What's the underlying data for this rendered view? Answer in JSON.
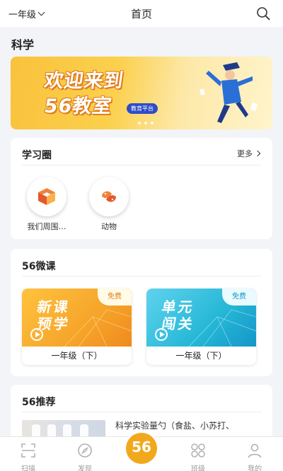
{
  "header": {
    "grade": "一年级",
    "title": "首页"
  },
  "subject": "科学",
  "banner": {
    "line1": "欢迎来到",
    "line2": "56教室",
    "tag": "教育平台"
  },
  "study_circle": {
    "title": "学习圈",
    "more": "更多",
    "items": [
      {
        "label": "我们周围…",
        "icon": "cube-icon"
      },
      {
        "label": "动物",
        "icon": "fish-icon"
      }
    ]
  },
  "micro_lessons": {
    "title": "56微课",
    "items": [
      {
        "art_line1": "新课",
        "art_line2": "预学",
        "badge": "免费",
        "caption": "一年级（下）",
        "color": "#f6a52a"
      },
      {
        "art_line1": "单元",
        "art_line2": "闯关",
        "badge": "免费",
        "caption": "一年级（下）",
        "color": "#25b7d6"
      }
    ]
  },
  "recommend": {
    "title": "56推荐",
    "text": "科学实验量勺（食盐、小苏打、"
  },
  "tabbar": {
    "items": [
      "扫描",
      "发现",
      "班级",
      "我的"
    ],
    "center": "56"
  },
  "colors": {
    "accent": "#f2a81d",
    "banner_tag": "#2f4cc9"
  }
}
